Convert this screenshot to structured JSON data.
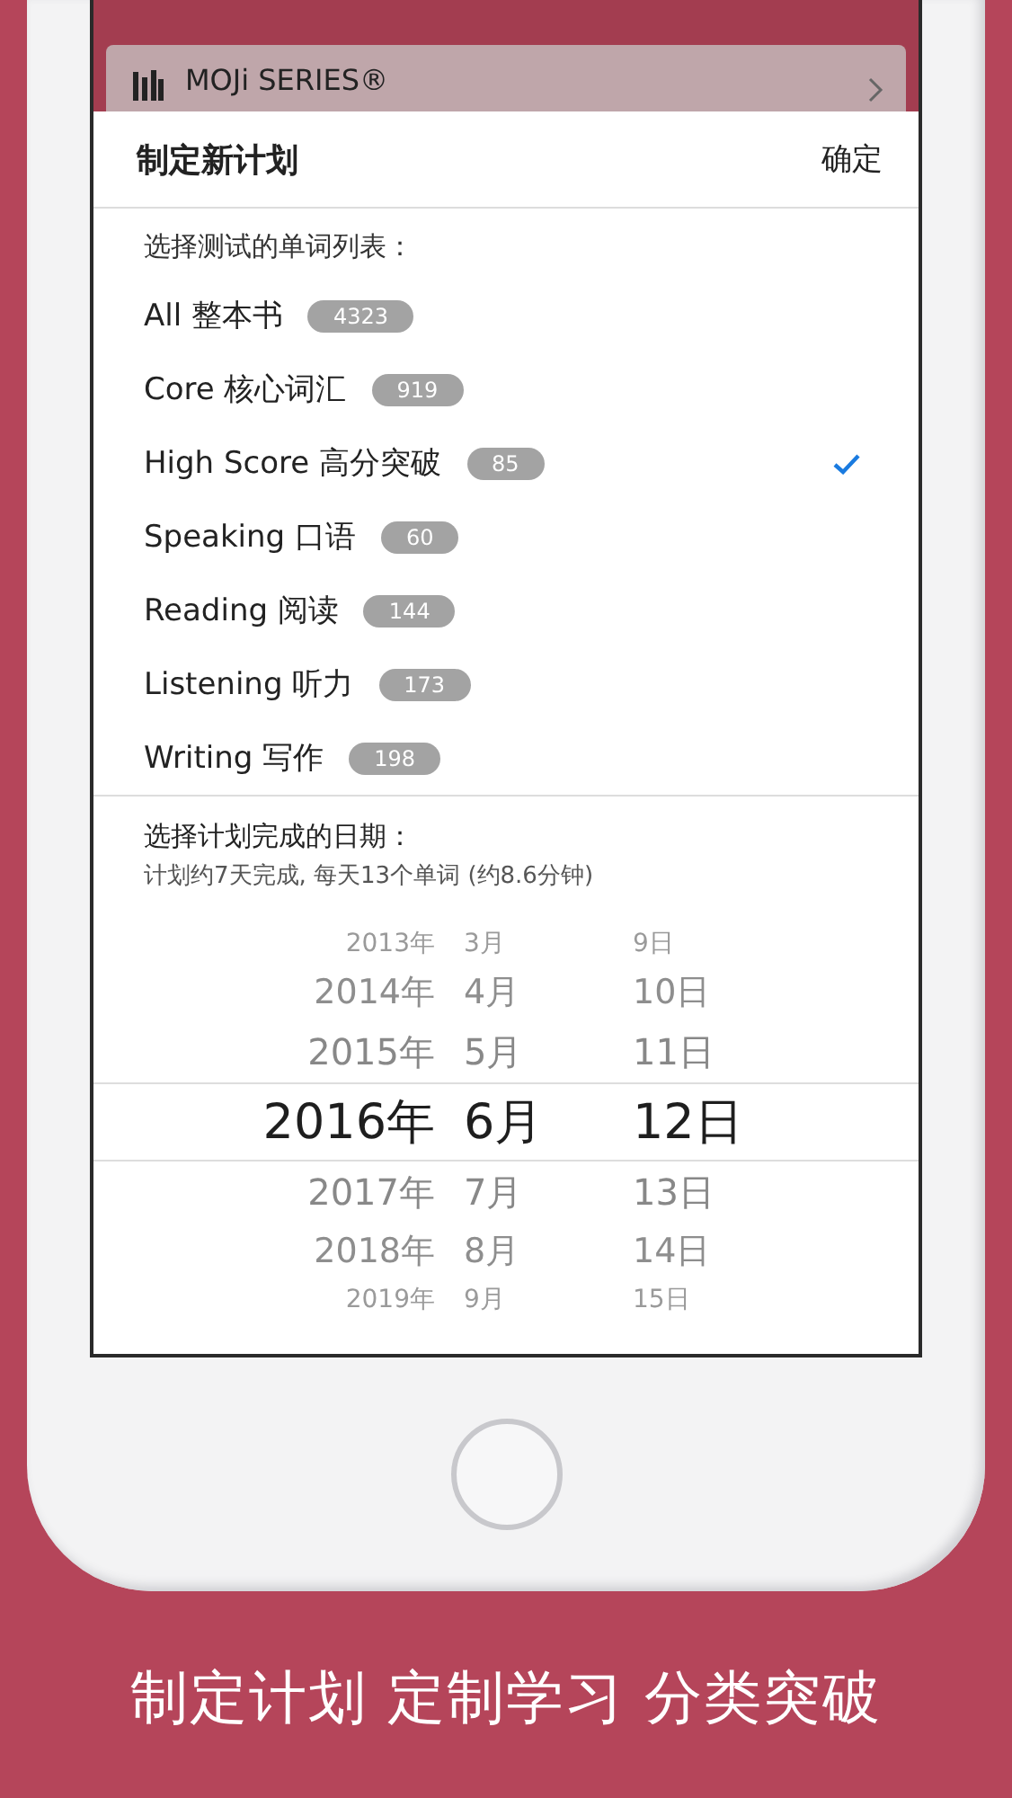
{
  "banner": {
    "title": "MOJi SERIES®"
  },
  "sheet": {
    "title": "制定新计划",
    "confirm": "确定"
  },
  "list_section": {
    "label": "选择测试的单词列表：",
    "items": [
      {
        "name": "All 整本书",
        "count": "4323",
        "selected": false
      },
      {
        "name": "Core 核心词汇",
        "count": "919",
        "selected": false
      },
      {
        "name": "High Score 高分突破",
        "count": "85",
        "selected": true
      },
      {
        "name": "Speaking 口语",
        "count": "60",
        "selected": false
      },
      {
        "name": "Reading 阅读",
        "count": "144",
        "selected": false
      },
      {
        "name": "Listening 听力",
        "count": "173",
        "selected": false
      },
      {
        "name": "Writing 写作",
        "count": "198",
        "selected": false
      }
    ]
  },
  "date_section": {
    "label": "选择计划完成的日期：",
    "summary": "计划约7天完成, 每天13个单词 (约8.6分钟)",
    "picker_rows": [
      {
        "year": "2013年",
        "month": "3月",
        "day": "9日",
        "selected": false
      },
      {
        "year": "2014年",
        "month": "4月",
        "day": "10日",
        "selected": false
      },
      {
        "year": "2015年",
        "month": "5月",
        "day": "11日",
        "selected": false
      },
      {
        "year": "2016年",
        "month": "6月",
        "day": "12日",
        "selected": true
      },
      {
        "year": "2017年",
        "month": "7月",
        "day": "13日",
        "selected": false
      },
      {
        "year": "2018年",
        "month": "8月",
        "day": "14日",
        "selected": false
      },
      {
        "year": "2019年",
        "month": "9月",
        "day": "15日",
        "selected": false
      }
    ]
  },
  "caption": "制定计划 定制学习 分类突破"
}
